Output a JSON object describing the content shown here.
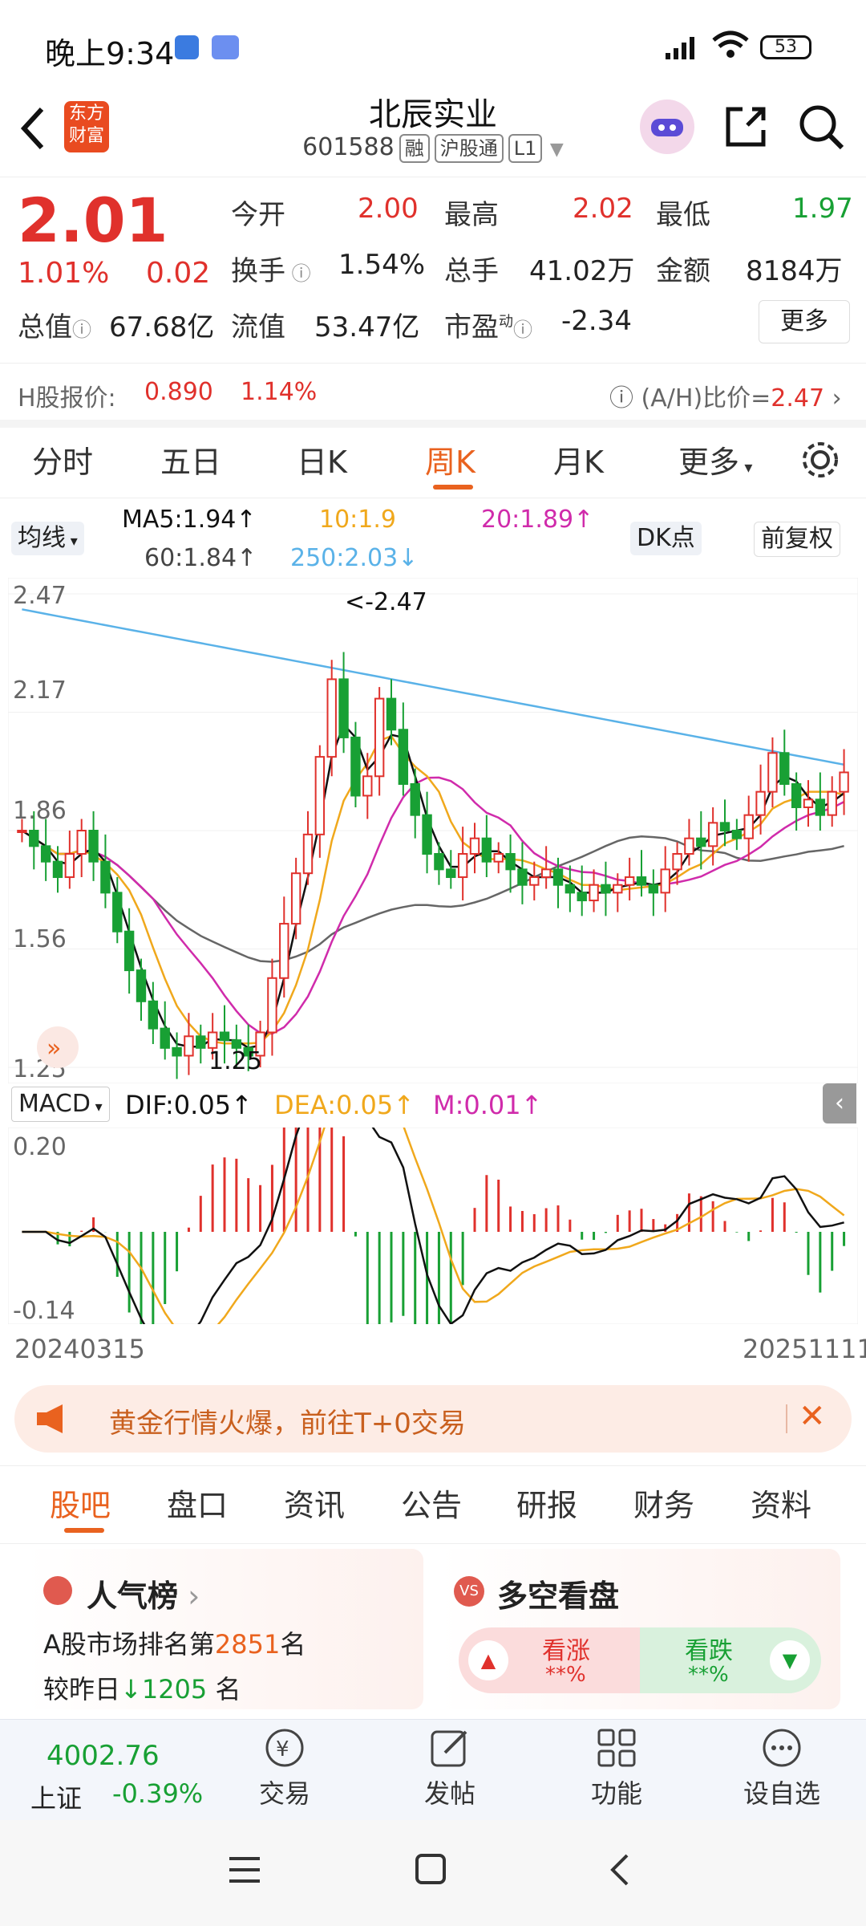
{
  "status_bar": {
    "time": "晚上9:34",
    "battery": "53"
  },
  "header": {
    "stock_name": "北辰实业",
    "stock_code": "601588",
    "tags": [
      "融",
      "沪股通",
      "L1"
    ],
    "logo_line1": "东方",
    "logo_line2": "财富"
  },
  "quote": {
    "price": "2.01",
    "change_pct": "1.01%",
    "change_amt": "0.02",
    "open_label": "今开",
    "open": "2.00",
    "high_label": "最高",
    "high": "2.02",
    "low_label": "最低",
    "low": "1.97",
    "turnover_label": "换手",
    "turnover": "1.54%",
    "volume_label": "总手",
    "volume": "41.02万",
    "amount_label": "金额",
    "amount": "8184万",
    "mktcap_label": "总值",
    "mktcap": "67.68亿",
    "float_label": "流值",
    "float_cap": "53.47亿",
    "pe_label": "市盈",
    "pe_sup": "动",
    "pe": "-2.34",
    "more_button": "更多"
  },
  "hshare": {
    "label": "H股报价:",
    "price": "0.890",
    "pct": "1.14%",
    "ah_label": "(A/H)比价=",
    "ah_value": "2.47"
  },
  "kline_tabs": [
    "分时",
    "五日",
    "日K",
    "周K",
    "月K",
    "更多"
  ],
  "active_tab": "周K",
  "indicators": {
    "ma_button": "均线",
    "ma5": "MA5:1.94↑",
    "ma10": "10:1.9",
    "ma20": "20:1.89↑",
    "ma60": "60:1.84↑",
    "ma250": "250:2.03↓",
    "dk_button": "DK点",
    "adjust_button": "前复权"
  },
  "chart_data": {
    "type": "candlestick",
    "y_ticks": [
      "2.47",
      "2.17",
      "1.86",
      "1.56",
      "1.25"
    ],
    "high_mark": "<-2.47",
    "low_mark": "1.25",
    "macd_label": "MACD",
    "dif": "DIF:0.05↑",
    "dea": "DEA:0.05↑",
    "m": "M:0.01↑",
    "macd_y_ticks": [
      "0.20",
      "-0.14"
    ],
    "start_date": "20240315",
    "end_date": "20251111",
    "close_series": [
      1.86,
      1.82,
      1.78,
      1.74,
      1.8,
      1.86,
      1.78,
      1.7,
      1.6,
      1.5,
      1.42,
      1.35,
      1.3,
      1.28,
      1.33,
      1.3,
      1.34,
      1.32,
      1.3,
      1.28,
      1.34,
      1.48,
      1.62,
      1.75,
      1.85,
      2.05,
      2.25,
      2.1,
      1.95,
      2.0,
      2.2,
      2.12,
      1.98,
      1.9,
      1.8,
      1.76,
      1.74,
      1.8,
      1.84,
      1.78,
      1.8,
      1.76,
      1.72,
      1.74,
      1.76,
      1.72,
      1.7,
      1.68,
      1.72,
      1.7,
      1.72,
      1.74,
      1.72,
      1.7,
      1.76,
      1.8,
      1.84,
      1.82,
      1.88,
      1.86,
      1.84,
      1.9,
      1.96,
      2.06,
      1.98,
      1.92,
      1.94,
      1.9,
      1.96,
      2.01
    ]
  },
  "banner": {
    "text": "黄金行情火爆，前往T+0交易"
  },
  "bottom_tabs": [
    "股吧",
    "盘口",
    "资讯",
    "公告",
    "研报",
    "财务",
    "资料"
  ],
  "cards": {
    "popularity_title": "人气榜",
    "rank_prefix": "A股市场排名第",
    "rank": "2851",
    "rank_suffix": "名",
    "compare_prefix": "较昨日",
    "compare_value": "1205",
    "compare_suffix": "名",
    "sentiment_title": "多空看盘",
    "bull_label": "看涨",
    "bull_pct": "**%",
    "bear_label": "看跌",
    "bear_pct": "**%"
  },
  "bottom_nav": {
    "index_value": "4002.76",
    "index_name": "上证",
    "index_change": "-0.39%",
    "items": [
      "交易",
      "发帖",
      "功能",
      "设自选"
    ]
  },
  "colors": {
    "up": "#e0312c",
    "down": "#18a034",
    "accent": "#e9621f"
  }
}
